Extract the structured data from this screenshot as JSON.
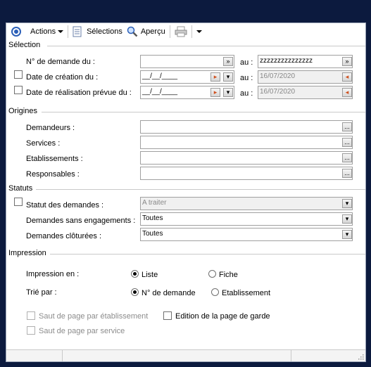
{
  "toolbar": {
    "actions_label": "Actions",
    "selections_label": "Sélections",
    "apercu_label": "Aperçu"
  },
  "selection": {
    "title": "Sélection",
    "num_demande_label": "N° de demande du :",
    "num_demande_from": "",
    "au_label": "au :",
    "num_demande_to": "zzzzzzzzzzzzzzz",
    "date_creation_label": "Date de création du :",
    "date_creation_from": "__/__/____",
    "date_creation_to": "16/07/2020",
    "date_realisation_label": "Date de réalisation prévue du :",
    "date_realisation_from": "__/__/____",
    "date_realisation_to": "16/07/2020"
  },
  "origines": {
    "title": "Origines",
    "demandeurs_label": "Demandeurs :",
    "services_label": "Services :",
    "etablissements_label": "Etablissements :",
    "responsables_label": "Responsables :",
    "ellipsis": "..."
  },
  "statuts": {
    "title": "Statuts",
    "statut_label": "Statut des demandes :",
    "statut_value": "A traiter",
    "sans_engagement_label": "Demandes sans engagements :",
    "sans_engagement_value": "Toutes",
    "cloturees_label": "Demandes clôturées :",
    "cloturees_value": "Toutes"
  },
  "impression": {
    "title": "Impression",
    "impression_en_label": "Impression en :",
    "liste_label": "Liste",
    "fiche_label": "Fiche",
    "trie_par_label": "Trié par :",
    "num_demande_option": "N° de demande",
    "etablissement_option": "Etablissement",
    "saut_etab_label": "Saut de page par établissement",
    "edition_garde_label": "Edition de la page de garde",
    "saut_service_label": "Saut de page par service"
  },
  "colors": {
    "background": "#0c1a3e",
    "accent": "#2b5fb8"
  }
}
